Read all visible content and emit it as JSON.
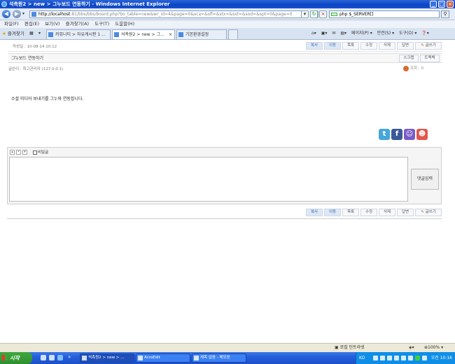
{
  "window": {
    "title": "석촉원2 > new > 그누보드 연동하기 - Windows Internet Explorer",
    "minimize": "_",
    "maximize": "□",
    "close": "×"
  },
  "address_bar": {
    "url_host": "http://localhost",
    "url_rest": ":81/bbs/bbs/board.php?bo_table=new&wr_id=4&page=0&sca=&sfl=&stx=&sst=&sod=&spt=0&page=0",
    "search_text": "php $_SERVER[]"
  },
  "menu": [
    "파일(F)",
    "편집(E)",
    "보기(V)",
    "즐겨찾기(A)",
    "도구(T)",
    "도움말(H)"
  ],
  "favorites_label": "즐겨찾기",
  "tabs": [
    {
      "label": "커뮤니티 > 자유게시판 1 ...",
      "close": ""
    },
    {
      "label": "석촉원2 > new > 그...",
      "close": "×"
    },
    {
      "label": "기본환경설정",
      "close": ""
    }
  ],
  "command_bar": [
    "페이지(P) ▾",
    "안전(S) ▾",
    "도구(O) ▾"
  ],
  "post": {
    "top_buttons": [
      "복사",
      "이동",
      "목록",
      "수정",
      "삭제",
      "답변",
      "글쓰기"
    ],
    "date": "작성일 : 10-08-14 10:12",
    "subject": "그누보드 연동하기",
    "scrap_button": "스크랩",
    "trackback_button": "트랙백",
    "writer": "글쓴이 : 최고관리자 (127.0.0.1)",
    "hits": "조회 : 0",
    "body": "소셜 미디어 보내기를 그누와 연동합니다."
  },
  "sns_icons": [
    "twitter-icon",
    "facebook-icon",
    "me2day-icon",
    "yozm-icon"
  ],
  "comment": {
    "secret_label": "비밀글",
    "submit_label": "댓글입력"
  },
  "bottom_buttons": [
    "복사",
    "이동",
    "목록",
    "수정",
    "삭제",
    "답변",
    "글쓰기"
  ],
  "status_bar": {
    "zone": "로컬 인트라넷",
    "zoom": "100%"
  },
  "taskbar": {
    "start": "시작",
    "tasks": [
      "석촉원2 > new > ...",
      "AcroEdit",
      "제목 없음 - 메모장"
    ],
    "lang": "KO",
    "clock": "오전 10:16"
  }
}
